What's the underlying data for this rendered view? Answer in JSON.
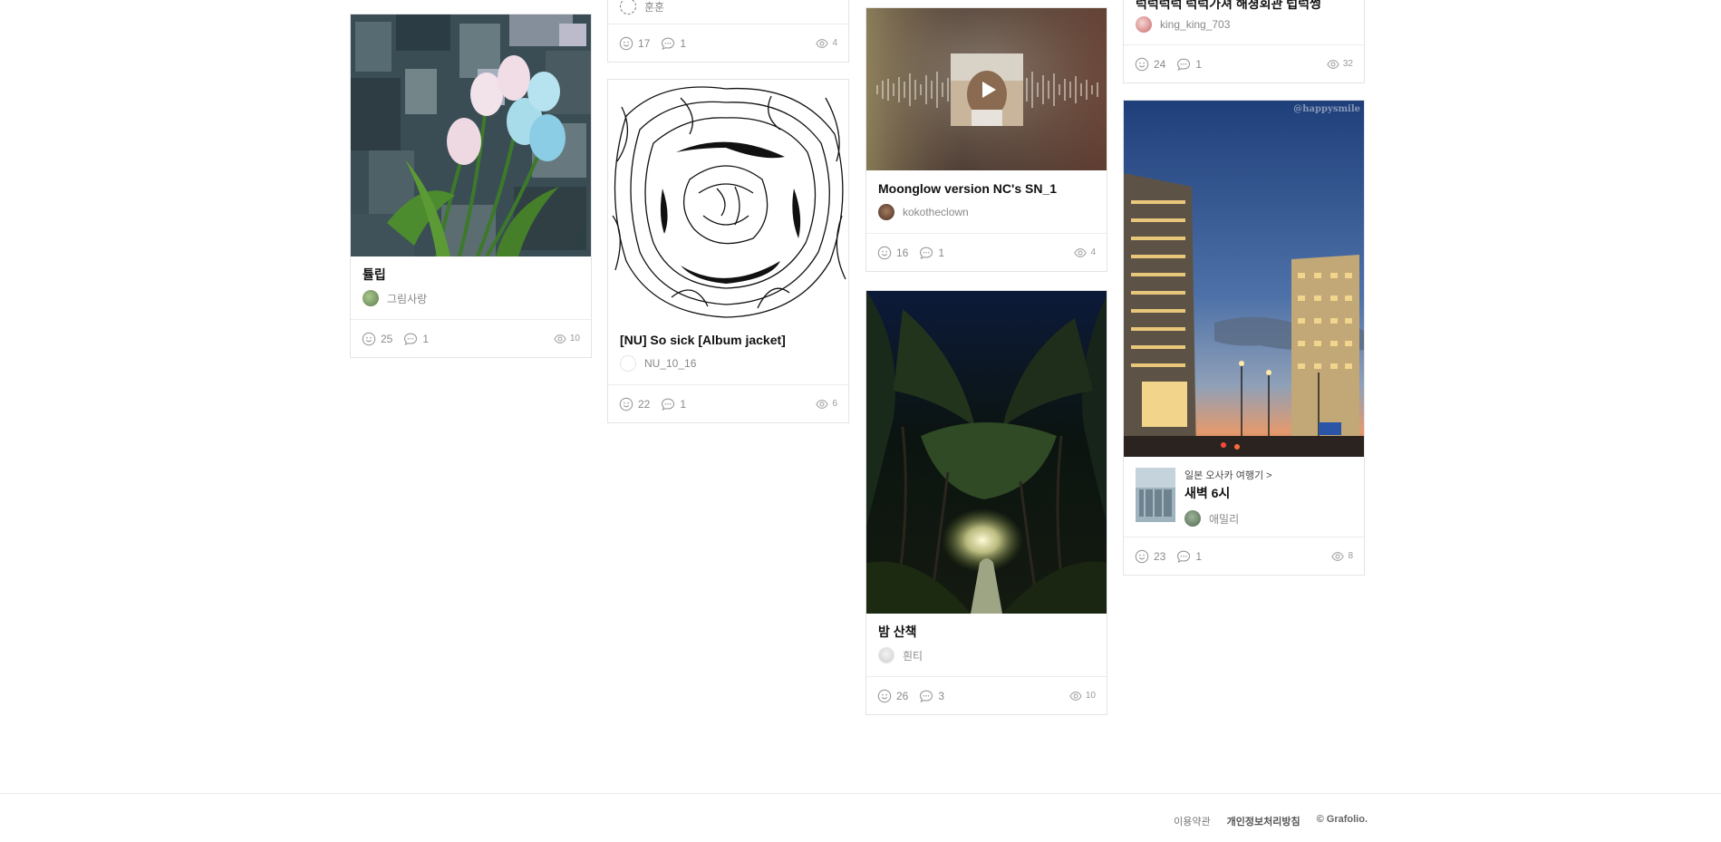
{
  "cards": [
    {
      "id": "tulip",
      "title": "튤립",
      "author": "그림사랑",
      "likes": "25",
      "comments": "1",
      "views": "10"
    },
    {
      "id": "top-col2",
      "author": "훈훈",
      "likes": "17",
      "comments": "1",
      "views": "4"
    },
    {
      "id": "so-sick",
      "title": "[NU] So sick [Album jacket]",
      "author": "NU_10_16",
      "likes": "22",
      "comments": "1",
      "views": "6"
    },
    {
      "id": "moonglow",
      "title": "Moonglow version NC's SN_1",
      "author": "kokotheclown",
      "likes": "16",
      "comments": "1",
      "views": "4"
    },
    {
      "id": "night-walk",
      "title": "밤 산책",
      "author": "흰티",
      "likes": "26",
      "comments": "3",
      "views": "10"
    },
    {
      "id": "top-col4",
      "title": "럭럭럭럭 럭럭가져 해졍회관 럽럭썽",
      "author": "king_king_703",
      "likes": "24",
      "comments": "1",
      "views": "32"
    },
    {
      "id": "dawn",
      "series_link": "일본 오사카 여행기 >",
      "title": "새벽 6시",
      "author": "애밀리",
      "watermark": "@happysmile",
      "likes": "23",
      "comments": "1",
      "views": "8"
    }
  ],
  "footer": {
    "terms": "이용약관",
    "privacy": "개인정보처리방침",
    "copyright": "© Grafolio."
  },
  "icons": {
    "like": "smile-icon",
    "comment": "speech-bubble-icon",
    "views": "eye-icon",
    "play": "play-icon"
  }
}
